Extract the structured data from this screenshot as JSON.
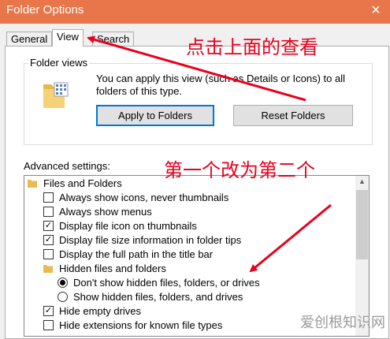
{
  "window": {
    "title": "Folder Options",
    "close_glyph": "×"
  },
  "tabs": [
    {
      "label": "General",
      "active": false
    },
    {
      "label": "View",
      "active": true
    },
    {
      "label": "Search",
      "active": false
    }
  ],
  "folder_views": {
    "legend": "Folder views",
    "description": "You can apply this view (such as Details or Icons) to all folders of this type.",
    "apply_button": "Apply to Folders",
    "reset_button": "Reset Folders",
    "icon": "folder-grid-icon"
  },
  "advanced": {
    "label": "Advanced settings:",
    "items": [
      {
        "type": "folder",
        "label": "Files and Folders"
      },
      {
        "type": "checkbox",
        "label": "Always show icons, never thumbnails",
        "checked": false
      },
      {
        "type": "checkbox",
        "label": "Always show menus",
        "checked": false
      },
      {
        "type": "checkbox",
        "label": "Display file icon on thumbnails",
        "checked": true
      },
      {
        "type": "checkbox",
        "label": "Display file size information in folder tips",
        "checked": true
      },
      {
        "type": "checkbox",
        "label": "Display the full path in the title bar",
        "checked": false
      },
      {
        "type": "folder",
        "label": "Hidden files and folders"
      },
      {
        "type": "radio",
        "label": "Don't show hidden files, folders, or drives",
        "checked": true
      },
      {
        "type": "radio",
        "label": "Show hidden files, folders, and drives",
        "checked": false
      },
      {
        "type": "checkbox",
        "label": "Hide empty drives",
        "checked": true
      },
      {
        "type": "checkbox",
        "label": "Hide extensions for known file types",
        "checked": false
      }
    ]
  },
  "annotations": {
    "top": "点击上面的查看",
    "middle": "第一个改为第二个",
    "color": "#e8001c"
  },
  "watermark": "爱创根知识网",
  "colors": {
    "titlebar": "#e8764a",
    "focus": "#0078d7"
  }
}
